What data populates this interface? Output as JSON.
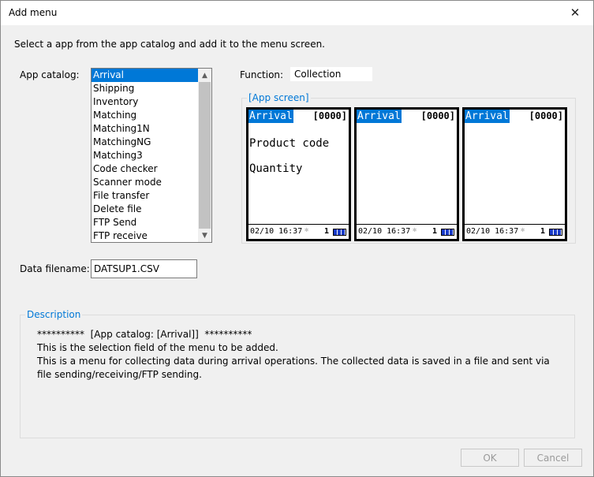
{
  "window": {
    "title": "Add menu",
    "close_glyph": "✕"
  },
  "instruction": "Select a app from the app catalog and add it to the menu screen.",
  "app_catalog": {
    "label": "App catalog:",
    "items": [
      "Arrival",
      "Shipping",
      "Inventory",
      "Matching",
      "Matching1N",
      "MatchingNG",
      "Matching3",
      "Code checker",
      "Scanner mode",
      "File transfer",
      "Delete file",
      "FTP Send",
      "FTP receive"
    ],
    "selected": "Arrival",
    "scroll_up_glyph": "▲",
    "scroll_down_glyph": "▼"
  },
  "function": {
    "label": "Function:",
    "value": "Collection"
  },
  "app_screen": {
    "label": "[App screen]",
    "screens": [
      {
        "title": "Arrival",
        "count": "[0000]",
        "lines": [
          "Product code",
          "Quantity"
        ],
        "time": "02/10 16:37",
        "num": "1"
      },
      {
        "title": "Arrival",
        "count": "[0000]",
        "lines": [],
        "time": "02/10 16:37",
        "num": "1"
      },
      {
        "title": "Arrival",
        "count": "[0000]",
        "lines": [],
        "time": "02/10 16:37",
        "num": "1"
      }
    ],
    "bluetooth_icon": "bluetooth-icon",
    "battery_icon": "battery-icon"
  },
  "data_filename": {
    "label": "Data filename:",
    "value": "DATSUP1.CSV"
  },
  "description": {
    "label": "Description",
    "lines": [
      "**********  [App catalog: [Arrival]]  **********",
      "This is the selection field of the menu to be added.",
      "This is a menu for collecting data during arrival operations. The collected data is saved in a file and sent via file sending/receiving/FTP sending."
    ]
  },
  "buttons": {
    "ok": "OK",
    "cancel": "Cancel"
  },
  "colors": {
    "accent": "#0078d7",
    "battery": "#1a3cc8"
  }
}
